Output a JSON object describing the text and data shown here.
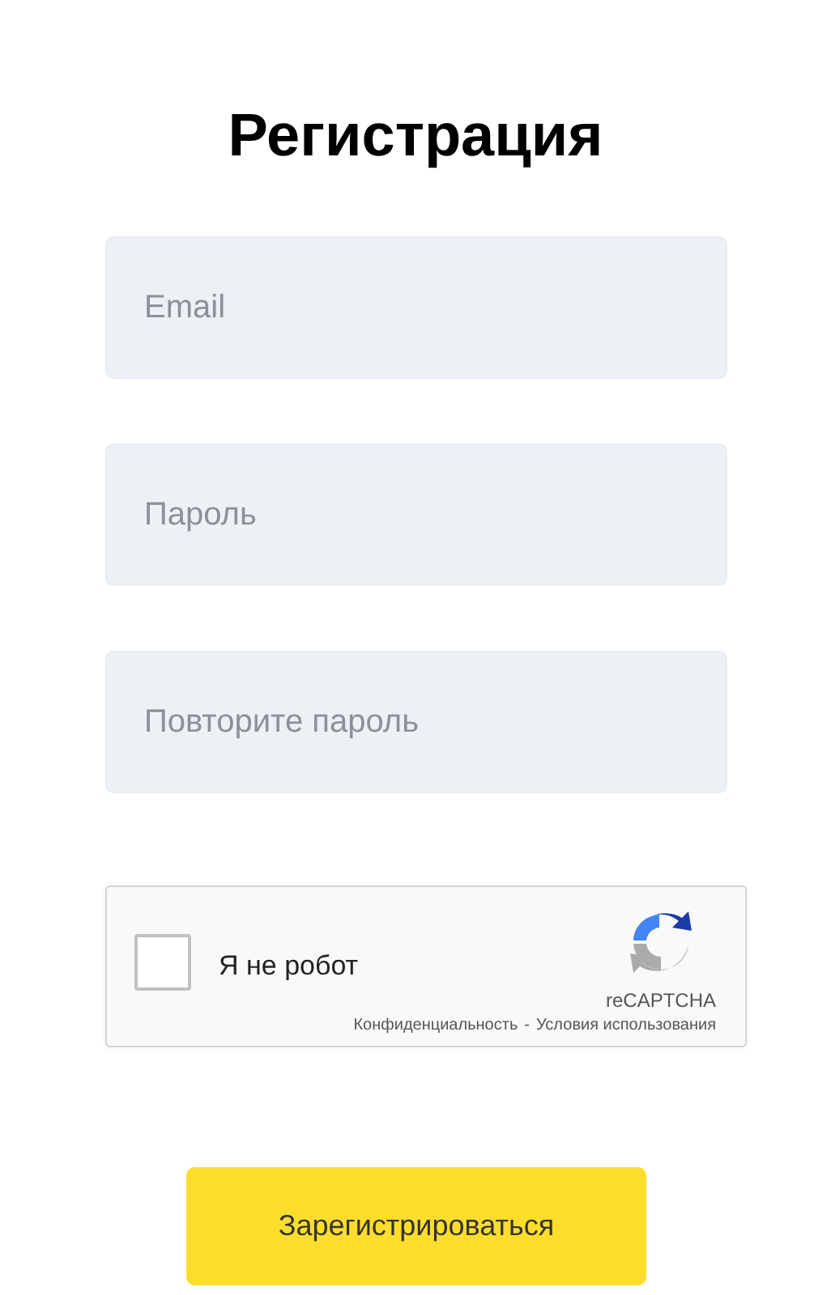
{
  "title": "Регистрация",
  "fields": [
    {
      "placeholder": "Email"
    },
    {
      "placeholder": "Пароль"
    },
    {
      "placeholder": "Повторите пароль"
    }
  ],
  "captcha": {
    "label": "Я не робот",
    "checked": false,
    "brand": "reCAPTCHA",
    "links": [
      "Конфиденциальность",
      "Условия использования"
    ],
    "separator": "-"
  },
  "submit": "Зарегистрироваться"
}
